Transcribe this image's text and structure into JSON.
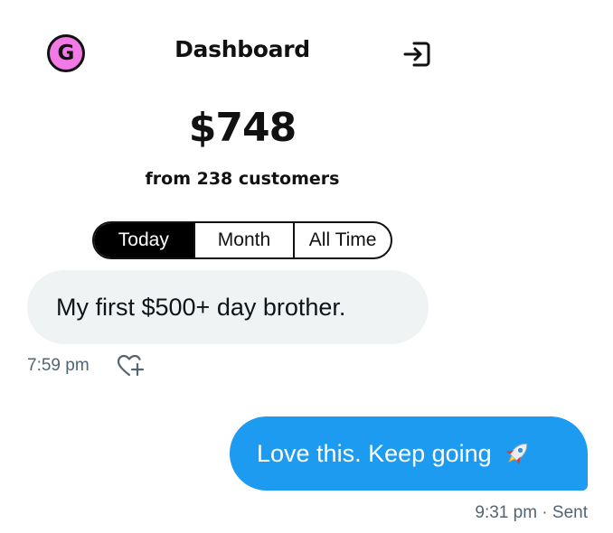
{
  "dashboard": {
    "avatar_letter": "G",
    "title": "Dashboard",
    "revenue": "$748",
    "subtitle": "from 238 customers",
    "tabs": [
      {
        "label": "Today",
        "active": true
      },
      {
        "label": "Month",
        "active": false
      },
      {
        "label": "All Time",
        "active": false
      }
    ]
  },
  "chat": {
    "incoming": {
      "text": "My first $500+ day brother.",
      "time": "7:59 pm"
    },
    "outgoing": {
      "text": "Love this. Keep going",
      "emoji": "rocket-emoji",
      "status": "9:31 pm · Sent"
    }
  },
  "colors": {
    "avatar_bg": "#f27ae6",
    "incoming_bubble": "#eff3f4",
    "outgoing_bubble": "#1d9bf0",
    "meta_text": "#536471"
  },
  "icons": [
    "logout-icon",
    "heart-add-icon",
    "rocket-icon"
  ]
}
